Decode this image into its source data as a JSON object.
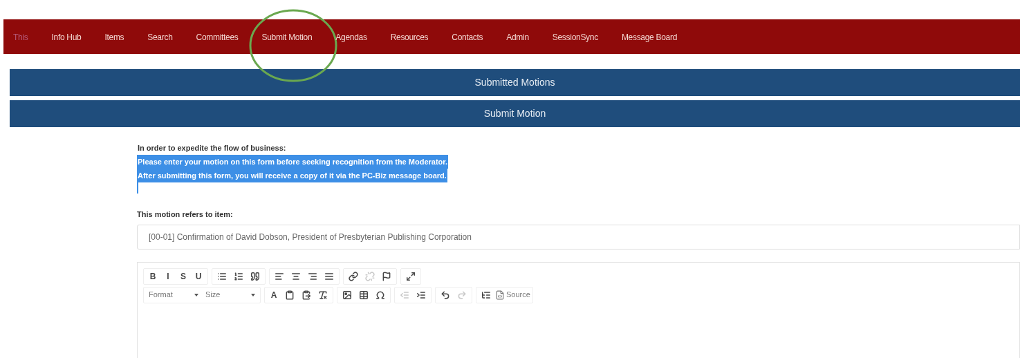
{
  "nav": {
    "items": [
      {
        "label": "This",
        "faint": true,
        "highlighted": false
      },
      {
        "label": "Info Hub",
        "faint": false,
        "highlighted": false
      },
      {
        "label": "Items",
        "faint": false,
        "highlighted": false
      },
      {
        "label": "Search",
        "faint": false,
        "highlighted": false
      },
      {
        "label": "Committees",
        "faint": false,
        "highlighted": false
      },
      {
        "label": "Submit Motion",
        "faint": false,
        "highlighted": true
      },
      {
        "label": "Agendas",
        "faint": false,
        "highlighted": false
      },
      {
        "label": "Resources",
        "faint": false,
        "highlighted": false
      },
      {
        "label": "Contacts",
        "faint": false,
        "highlighted": false
      },
      {
        "label": "Admin",
        "faint": false,
        "highlighted": false
      },
      {
        "label": "SessionSync",
        "faint": false,
        "highlighted": false
      },
      {
        "label": "Message Board",
        "faint": false,
        "highlighted": false
      }
    ]
  },
  "section_bars": [
    "Submitted Motions",
    "Submit Motion"
  ],
  "intro": [
    {
      "text": "In order to expedite the flow of business:",
      "selected": false
    },
    {
      "text": "Please enter your motion on this form before seeking recognition from the Moderator.",
      "selected": true
    },
    {
      "text": "After submitting this form, you will receive a copy of it via the PC-Biz message board.",
      "selected": true
    }
  ],
  "item_field": {
    "label": "This motion refers to item:",
    "value": "[00-01] Confirmation of David Dobson, President of Presbyterian Publishing Corporation"
  },
  "editor": {
    "toolbar_rows": [
      [
        [
          {
            "kind": "text",
            "label": "B",
            "disabled": false
          },
          {
            "kind": "text",
            "label": "I",
            "disabled": false
          },
          {
            "kind": "text",
            "label": "S",
            "disabled": false
          },
          {
            "kind": "text",
            "label": "U",
            "disabled": false
          }
        ],
        [
          {
            "kind": "icon",
            "disabled": false
          },
          {
            "kind": "icon",
            "disabled": false
          },
          {
            "kind": "icon",
            "disabled": false
          }
        ],
        [
          {
            "kind": "icon",
            "disabled": false
          },
          {
            "kind": "icon",
            "disabled": false
          },
          {
            "kind": "icon",
            "disabled": false
          },
          {
            "kind": "icon",
            "disabled": false
          }
        ],
        [
          {
            "kind": "icon",
            "disabled": false
          },
          {
            "kind": "icon",
            "disabled": true
          },
          {
            "kind": "icon",
            "disabled": false
          }
        ],
        [
          {
            "kind": "icon",
            "disabled": false
          }
        ]
      ],
      [
        [
          {
            "kind": "dropdown",
            "label": "Format"
          },
          {
            "kind": "dropdown",
            "label": "Size"
          }
        ],
        [
          {
            "kind": "text",
            "label": "A",
            "disabled": false
          },
          {
            "kind": "icon",
            "disabled": false
          },
          {
            "kind": "icon",
            "disabled": false
          },
          {
            "kind": "icon",
            "disabled": false
          }
        ],
        [
          {
            "kind": "icon",
            "disabled": false
          },
          {
            "kind": "icon",
            "disabled": false
          },
          {
            "kind": "icon",
            "disabled": false
          }
        ],
        [
          {
            "kind": "icon",
            "disabled": true
          },
          {
            "kind": "icon",
            "disabled": false
          }
        ],
        [
          {
            "kind": "icon",
            "disabled": false
          },
          {
            "kind": "icon",
            "disabled": true
          }
        ],
        [
          {
            "kind": "icon",
            "disabled": false
          },
          {
            "kind": "icon_text",
            "label": "Source",
            "disabled": false
          }
        ]
      ]
    ]
  }
}
